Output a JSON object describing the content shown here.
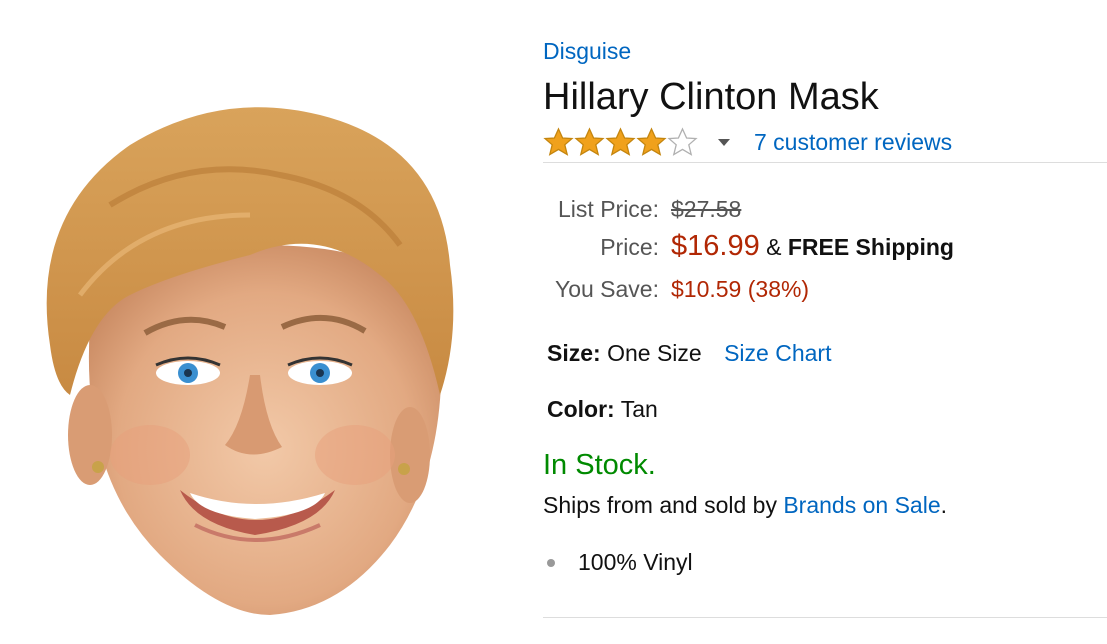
{
  "product": {
    "brand": "Disguise",
    "title": "Hillary Clinton Mask",
    "rating": 4,
    "rating_max": 5,
    "reviews_label": "7 customer reviews"
  },
  "pricing": {
    "list_label": "List Price:",
    "list_value": "$27.58",
    "price_label": "Price:",
    "price_value": "$16.99",
    "shipping_amp": "&",
    "shipping_text": "FREE Shipping",
    "save_label": "You Save:",
    "save_value": "$10.59 (38%)"
  },
  "attributes": {
    "size_label": "Size:",
    "size_value": "One Size",
    "size_chart_label": "Size Chart",
    "color_label": "Color:",
    "color_value": "Tan"
  },
  "availability": {
    "stock": "In Stock.",
    "ships_prefix": "Ships from and sold by",
    "seller": "Brands on Sale",
    "ships_suffix": "."
  },
  "features": [
    "100% Vinyl"
  ],
  "colors": {
    "link": "#0066c0",
    "price": "#b12704",
    "in_stock": "#008a00",
    "star": "#f0a11c"
  },
  "icons": {
    "rating_stars": "star-icon",
    "rating_dropdown": "chevron-down-icon"
  }
}
